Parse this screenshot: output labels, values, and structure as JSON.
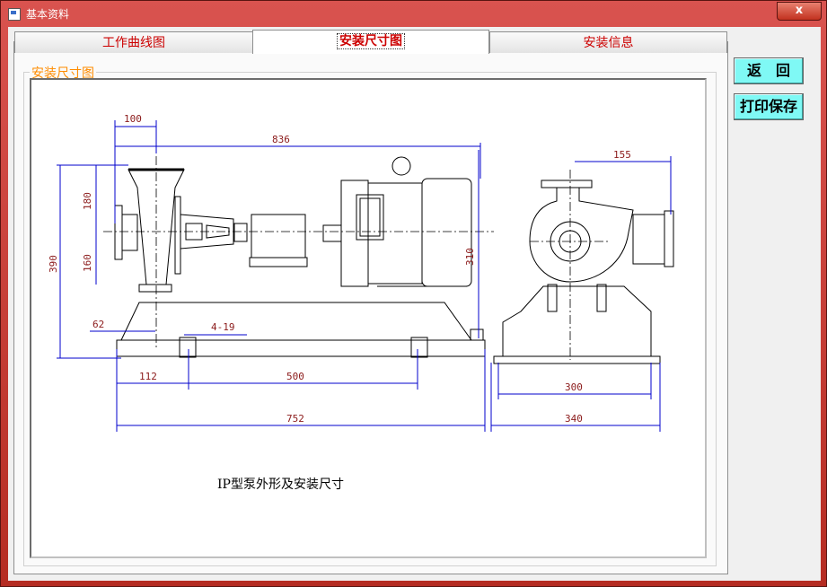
{
  "window": {
    "title": "基本资料",
    "close_symbol": "x"
  },
  "tabs": [
    {
      "label": "工作曲线图",
      "active": false
    },
    {
      "label": "安装尺寸图",
      "active": true
    },
    {
      "label": "安装信息",
      "active": false
    }
  ],
  "group": {
    "label": "安装尺寸图"
  },
  "buttons": {
    "back": "返　回",
    "print_save": "打印保存"
  },
  "drawing": {
    "caption": "IP型泵外形及安装尺寸",
    "dims": {
      "d100": "100",
      "d836": "836",
      "d155": "155",
      "d180": "180",
      "d160": "160",
      "d390": "390",
      "d310": "310",
      "d62": "62",
      "d419": "4-19",
      "d112": "112",
      "d500": "500",
      "d752": "752",
      "d300": "300",
      "d340": "340"
    }
  },
  "colors": {
    "dim_line": "#0000cc",
    "dim_text": "#8b1a1a",
    "outline": "#000000",
    "tab_text": "#cc0000",
    "group_label": "#ff8c00",
    "button_bg": "#7ff9f5"
  }
}
